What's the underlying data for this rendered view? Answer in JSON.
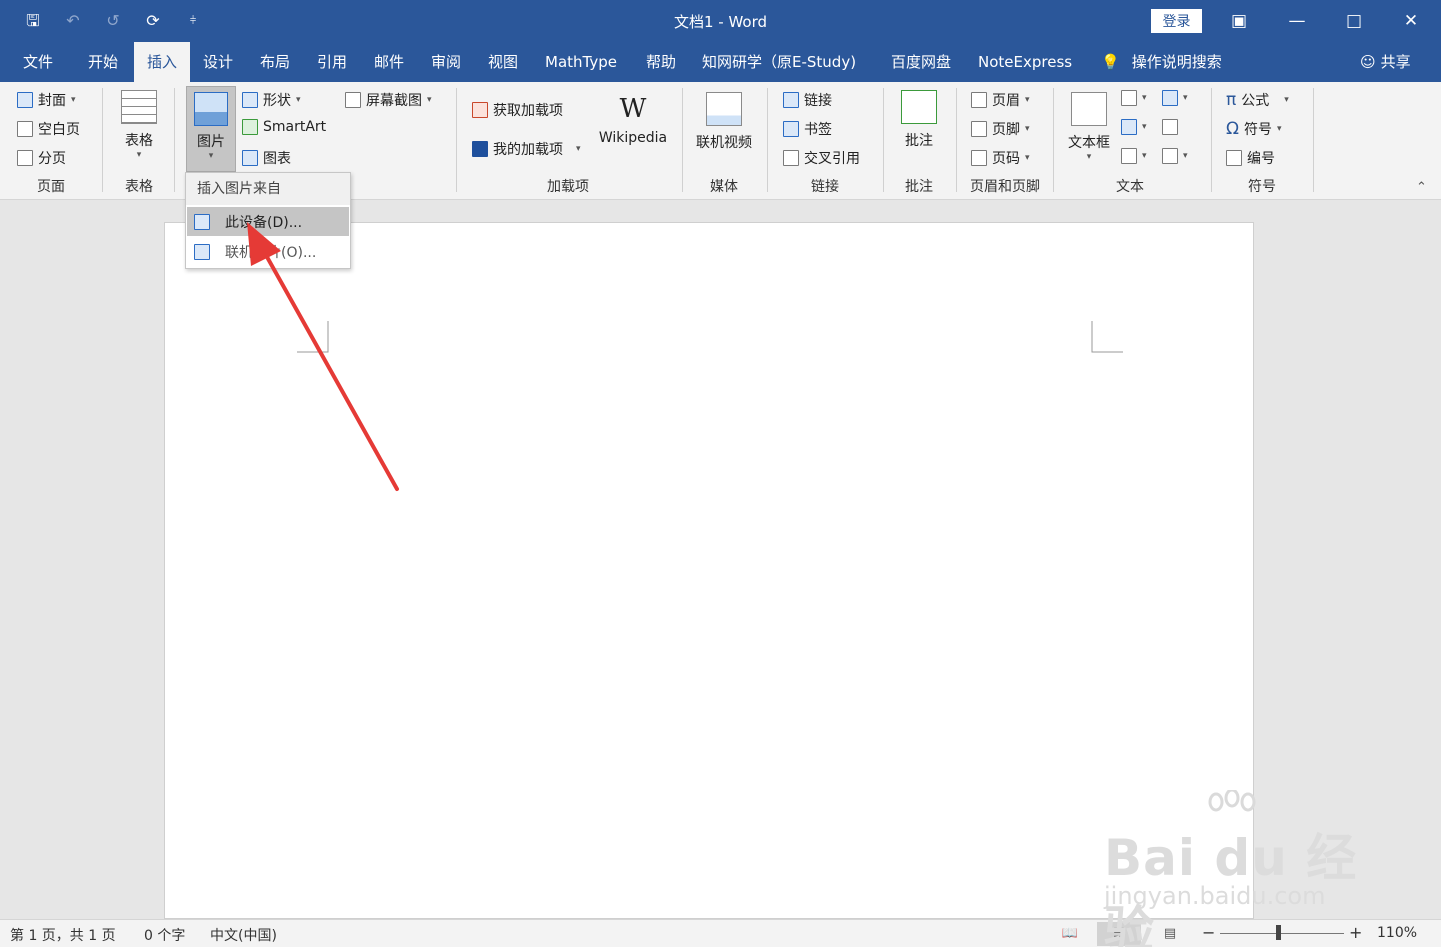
{
  "window": {
    "title": "文档1  -  Word",
    "login_label": "登录",
    "restore_ribbon_icon": "ribbon-display-icon",
    "minimize_icon": "minimize-icon",
    "maximize_icon": "maximize-icon",
    "close_icon": "close-icon"
  },
  "quick_access": {
    "save_icon": "save-icon",
    "undo_icon": "undo-icon",
    "redo_icon": "redo-icon",
    "refresh_icon": "refresh-icon",
    "customize_icon": "customize-icon"
  },
  "tabs": [
    {
      "label": "文件"
    },
    {
      "label": "开始"
    },
    {
      "label": "插入",
      "active": true
    },
    {
      "label": "设计"
    },
    {
      "label": "布局"
    },
    {
      "label": "引用"
    },
    {
      "label": "邮件"
    },
    {
      "label": "审阅"
    },
    {
      "label": "视图"
    },
    {
      "label": "MathType"
    },
    {
      "label": "帮助"
    },
    {
      "label": "知网研学（原E-Study)"
    },
    {
      "label": "百度网盘"
    },
    {
      "label": "NoteExpress"
    }
  ],
  "tell_me": "操作说明搜索",
  "share": "共享",
  "ribbon": {
    "pages": {
      "cover": "封面",
      "blank": "空白页",
      "break": "分页",
      "group": "页面"
    },
    "tables": {
      "table": "表格",
      "group": "表格"
    },
    "illustrations": {
      "pictures": "图片",
      "shapes": "形状",
      "smartart": "SmartArt",
      "chart": "图表",
      "screenshot": "屏幕截图"
    },
    "addins": {
      "get": "获取加载项",
      "my": "我的加载项",
      "wikipedia": "Wikipedia",
      "group": "加载项"
    },
    "media": {
      "video": "联机视频",
      "group": "媒体"
    },
    "links": {
      "link": "链接",
      "bookmark": "书签",
      "crossref": "交叉引用",
      "group": "链接"
    },
    "comments": {
      "comment": "批注",
      "group": "批注"
    },
    "header_footer": {
      "header": "页眉",
      "footer": "页脚",
      "page_number": "页码",
      "group": "页眉和页脚"
    },
    "text": {
      "textbox": "文本框",
      "group": "文本"
    },
    "symbols": {
      "equation": "公式",
      "symbol": "符号",
      "numbering": "编号",
      "group": "符号"
    }
  },
  "dropdown": {
    "header": "插入图片来自",
    "items": [
      {
        "label": "此设备(D)..."
      },
      {
        "label": "联机图片(O)..."
      }
    ]
  },
  "watermark": {
    "brand": "Bai du 经验",
    "url": "jingyan.baidu.com"
  },
  "statusbar": {
    "page": "第 1 页，共 1 页",
    "words": "0 个字",
    "language": "中文(中国)",
    "zoom_minus": "−",
    "zoom_plus": "+",
    "zoom": "110%",
    "zoom_fraction": 0.47
  },
  "colors": {
    "accent": "#2b579a",
    "arrow": "#e53a36"
  }
}
